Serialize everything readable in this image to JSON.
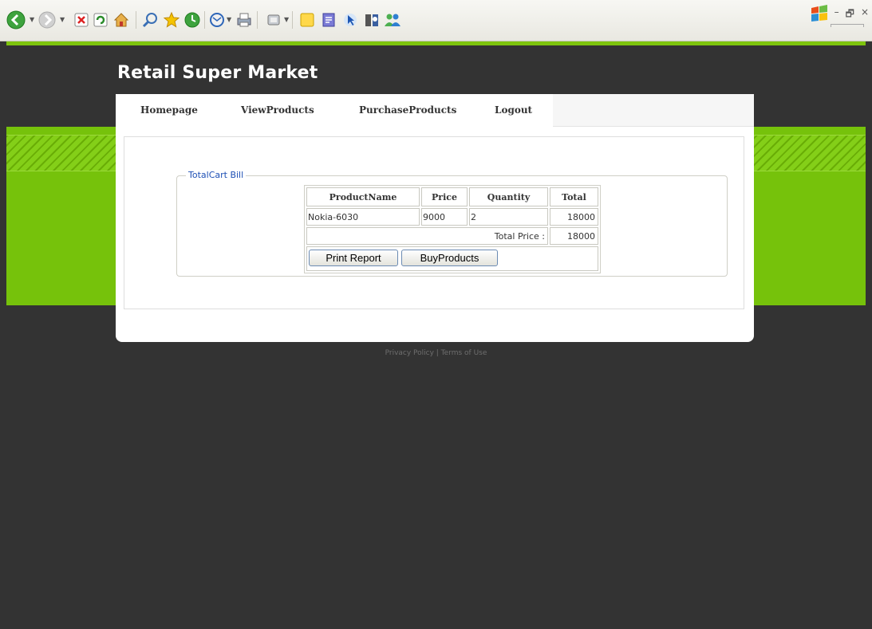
{
  "browser": {
    "toolbar_icons": [
      "back-icon",
      "forward-icon",
      "stop-icon",
      "refresh-icon",
      "home-icon",
      "search-icon",
      "favorites-icon",
      "history-icon",
      "mail-icon",
      "print-icon",
      "edit-icon",
      "discuss-icon",
      "messenger-icon",
      "research-icon",
      "cursor-icon",
      "windows-icon"
    ],
    "window_controls": {
      "minimize": "–",
      "restore": "🗗",
      "close": "×"
    }
  },
  "site": {
    "title": "Retail Super Market",
    "colors": {
      "background": "#333333",
      "accent_green": "#76c20b"
    }
  },
  "nav": {
    "items": [
      {
        "label": "Homepage"
      },
      {
        "label": "ViewProducts"
      },
      {
        "label": "PurchaseProducts"
      },
      {
        "label": "Logout"
      }
    ]
  },
  "bill": {
    "legend": "TotalCart Bill",
    "headers": [
      "ProductName",
      "Price",
      "Quantity",
      "Total"
    ],
    "rows": [
      {
        "product": "Nokia-6030",
        "price": "9000",
        "quantity": "2",
        "total": "18000"
      }
    ],
    "total_label": "Total Price :",
    "total_value": "18000",
    "buttons": {
      "print": "Print Report",
      "buy": "BuyProducts"
    }
  },
  "footer": {
    "text": "Privacy Policy | Terms of Use"
  }
}
